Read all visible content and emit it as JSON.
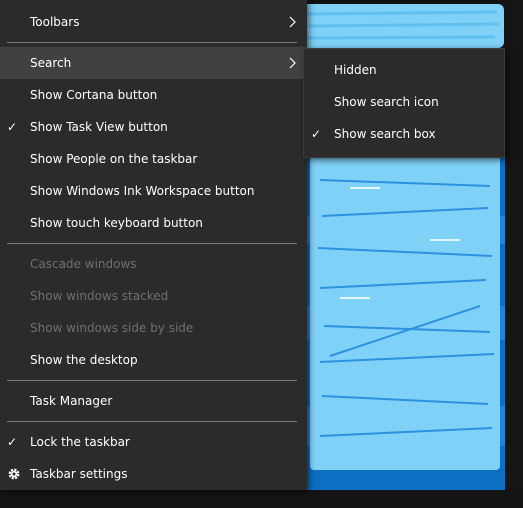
{
  "context_menu": {
    "items": [
      {
        "label": "Toolbars",
        "checked": false,
        "disabled": false,
        "has_submenu": true
      },
      {
        "label": "Search",
        "checked": false,
        "disabled": false,
        "has_submenu": true,
        "highlighted": true
      },
      {
        "label": "Show Cortana button",
        "checked": false,
        "disabled": false
      },
      {
        "label": "Show Task View button",
        "checked": true,
        "disabled": false
      },
      {
        "label": "Show People on the taskbar",
        "checked": false,
        "disabled": false
      },
      {
        "label": "Show Windows Ink Workspace button",
        "checked": false,
        "disabled": false
      },
      {
        "label": "Show touch keyboard button",
        "checked": false,
        "disabled": false
      },
      {
        "label": "Cascade windows",
        "checked": false,
        "disabled": true
      },
      {
        "label": "Show windows stacked",
        "checked": false,
        "disabled": true
      },
      {
        "label": "Show windows side by side",
        "checked": false,
        "disabled": true
      },
      {
        "label": "Show the desktop",
        "checked": false,
        "disabled": false
      },
      {
        "label": "Task Manager",
        "checked": false,
        "disabled": false
      },
      {
        "label": "Lock the taskbar",
        "checked": true,
        "disabled": false
      },
      {
        "label": "Taskbar settings",
        "checked": false,
        "disabled": false,
        "icon": "gear-icon"
      }
    ],
    "check_glyph": "✓"
  },
  "search_submenu": {
    "items": [
      {
        "label": "Hidden",
        "checked": false
      },
      {
        "label": "Show search icon",
        "checked": false
      },
      {
        "label": "Show search box",
        "checked": true
      }
    ]
  },
  "colors": {
    "menu_bg": "#2b2b2b",
    "highlight_bg": "#414141",
    "text": "#ffffff",
    "disabled_text": "#6f6f6f",
    "redaction": "#7fd1f7",
    "desktop_blue": "#0d6fc4"
  }
}
